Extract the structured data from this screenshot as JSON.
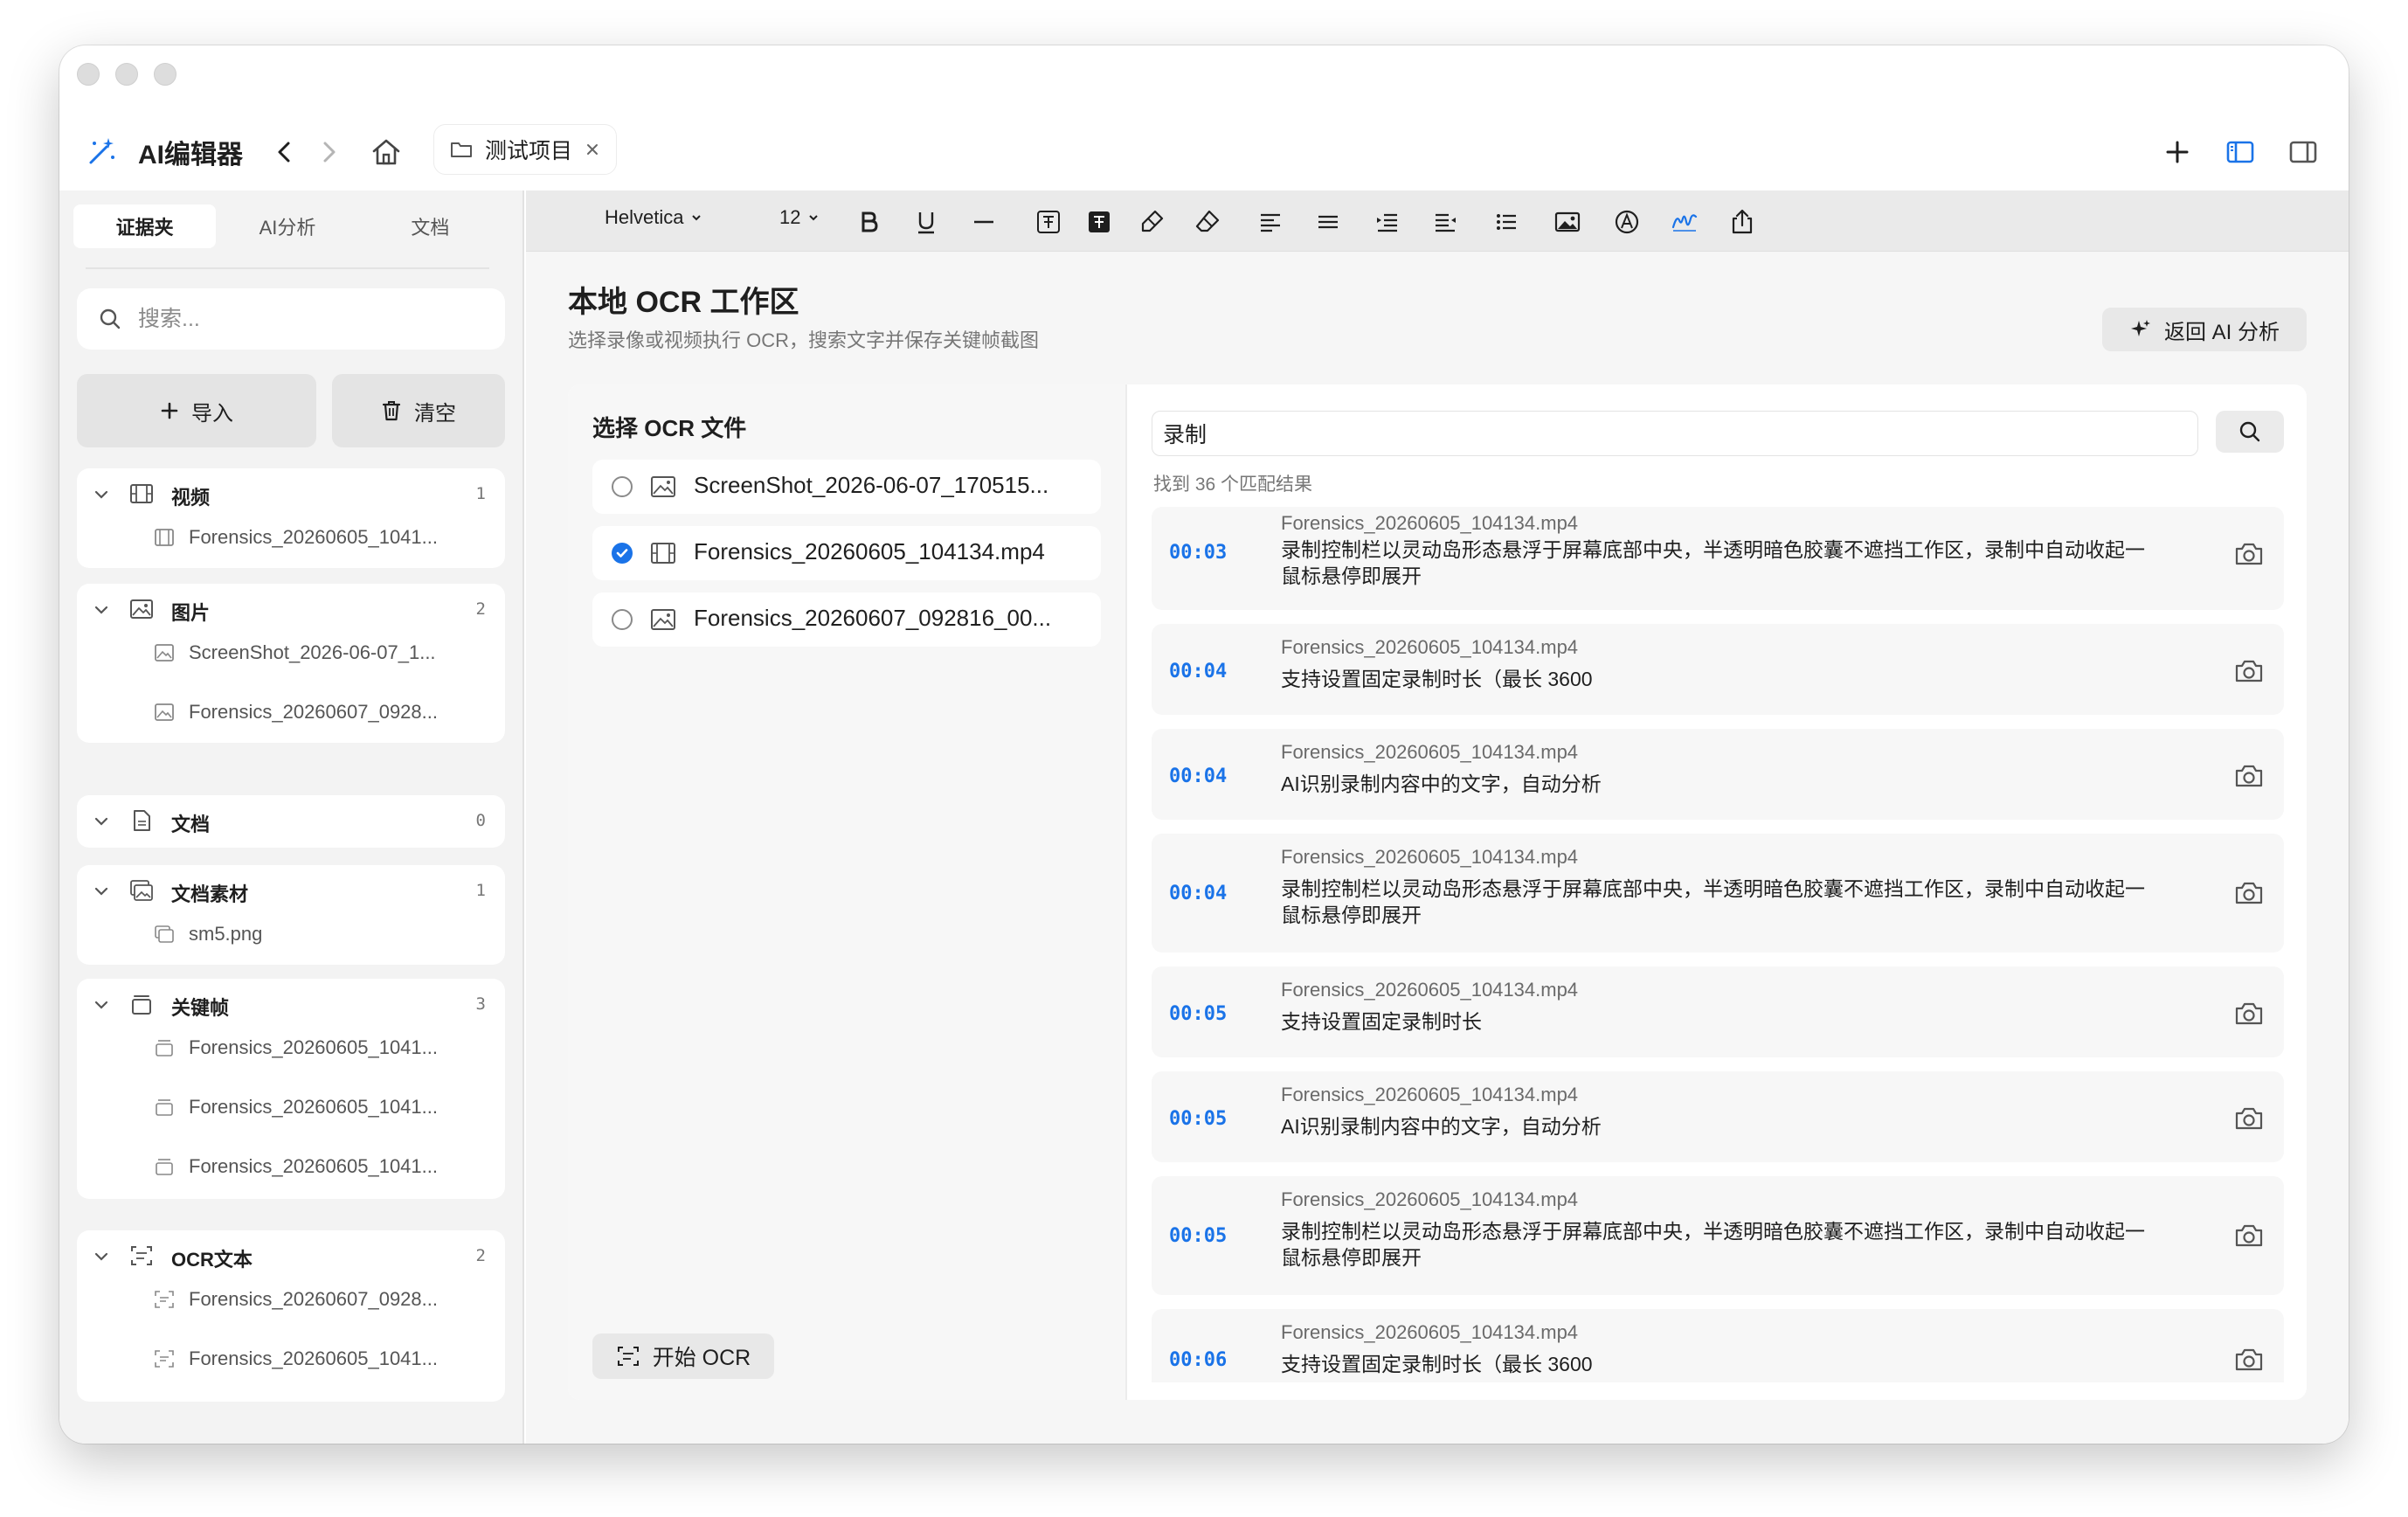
{
  "app": {
    "title": "AI编辑器",
    "project_tab": "测试项目"
  },
  "sidebar": {
    "tabs": [
      "证据夹",
      "AI分析",
      "文档"
    ],
    "active_tab": 0,
    "search_placeholder": "搜索...",
    "import_label": "导入",
    "clear_label": "清空",
    "groups": [
      {
        "name": "视频",
        "count": "1",
        "icon": "film-icon",
        "items": [
          "Forensics_20260605_1041..."
        ]
      },
      {
        "name": "图片",
        "count": "2",
        "icon": "image-icon",
        "items": [
          "ScreenShot_2026-06-07_1...",
          "Forensics_20260607_0928..."
        ]
      },
      {
        "name": "文档",
        "count": "0",
        "icon": "document-icon",
        "items": []
      },
      {
        "name": "文档素材",
        "count": "1",
        "icon": "photo-stack-icon",
        "items": [
          "sm5.png"
        ]
      },
      {
        "name": "关键帧",
        "count": "3",
        "icon": "keyframe-icon",
        "items": [
          "Forensics_20260605_1041...",
          "Forensics_20260605_1041...",
          "Forensics_20260605_1041..."
        ]
      },
      {
        "name": "OCR文本",
        "count": "2",
        "icon": "text-scan-icon",
        "items": [
          "Forensics_20260607_0928...",
          "Forensics_20260605_1041..."
        ]
      }
    ]
  },
  "toolbar": {
    "font": "Helvetica",
    "size": "12"
  },
  "workspace": {
    "title": "本地 OCR 工作区",
    "subtitle": "选择录像或视频执行 OCR，搜索文字并保存关键帧截图",
    "back_button": "返回 AI 分析",
    "file_list_title": "选择 OCR 文件",
    "files": [
      {
        "name": "ScreenShot_2026-06-07_170515...",
        "checked": false,
        "icon": "image-icon"
      },
      {
        "name": "Forensics_20260605_104134.mp4",
        "checked": true,
        "icon": "film-icon"
      },
      {
        "name": "Forensics_20260607_092816_00...",
        "checked": false,
        "icon": "image-icon"
      }
    ],
    "start_ocr": "开始 OCR",
    "query": "录制",
    "match_count": "找到 36 个匹配结果",
    "results": [
      {
        "time": "00:03",
        "file": "Forensics_20260605_104134.mp4",
        "text": "录制控制栏以灵动岛形态悬浮于屏幕底部中央，半透明暗色胶囊不遮挡工作区，录制中自动收起一鼠标悬停即展开"
      },
      {
        "time": "00:04",
        "file": "Forensics_20260605_104134.mp4",
        "text": "支持设置固定录制时长（最长 3600"
      },
      {
        "time": "00:04",
        "file": "Forensics_20260605_104134.mp4",
        "text": "AI识别录制内容中的文字，自动分析"
      },
      {
        "time": "00:04",
        "file": "Forensics_20260605_104134.mp4",
        "text": "录制控制栏以灵动岛形态悬浮于屏幕底部中央，半透明暗色胶囊不遮挡工作区，录制中自动收起一鼠标悬停即展开"
      },
      {
        "time": "00:05",
        "file": "Forensics_20260605_104134.mp4",
        "text": "支持设置固定录制时长"
      },
      {
        "time": "00:05",
        "file": "Forensics_20260605_104134.mp4",
        "text": "AI识别录制内容中的文字，自动分析"
      },
      {
        "time": "00:05",
        "file": "Forensics_20260605_104134.mp4",
        "text": "录制控制栏以灵动岛形态悬浮于屏幕底部中央，半透明暗色胶囊不遮挡工作区，录制中自动收起一鼠标悬停即展开"
      },
      {
        "time": "00:06",
        "file": "Forensics_20260605_104134.mp4",
        "text": "支持设置固定录制时长（最长 3600"
      }
    ]
  },
  "colors": {
    "accent": "#1a73e8",
    "sidebar_bg": "#f3f3f3",
    "toolbar_bg": "#eaeaea"
  }
}
